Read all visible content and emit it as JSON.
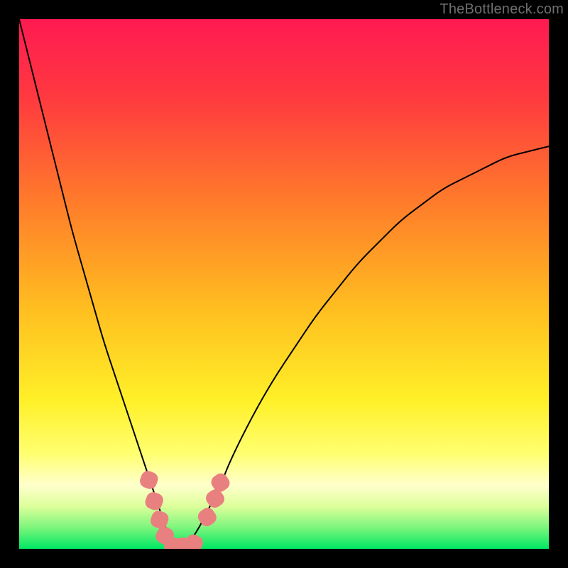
{
  "watermark": "TheBottleneck.com",
  "chart_data": {
    "type": "line",
    "title": "",
    "xlabel": "",
    "ylabel": "",
    "xlim": [
      0,
      100
    ],
    "ylim": [
      0,
      100
    ],
    "background": {
      "style": "vertical-gradient",
      "stops": [
        {
          "pos": 0.0,
          "color": "#ff1a52"
        },
        {
          "pos": 0.15,
          "color": "#ff3a3f"
        },
        {
          "pos": 0.35,
          "color": "#ff7d2a"
        },
        {
          "pos": 0.55,
          "color": "#ffbf20"
        },
        {
          "pos": 0.72,
          "color": "#fff028"
        },
        {
          "pos": 0.82,
          "color": "#ffff70"
        },
        {
          "pos": 0.88,
          "color": "#ffffcc"
        },
        {
          "pos": 0.92,
          "color": "#dcff9a"
        },
        {
          "pos": 0.96,
          "color": "#7cf57c"
        },
        {
          "pos": 1.0,
          "color": "#00e864"
        }
      ]
    },
    "series": [
      {
        "name": "bottleneck-curve",
        "stroke": "#000000",
        "stroke_width": 2,
        "x": [
          0,
          2,
          4,
          6,
          8,
          10,
          12,
          14,
          16,
          18,
          20,
          22,
          24,
          25,
          26,
          27,
          28,
          29,
          30,
          32,
          34,
          36,
          38,
          40,
          44,
          48,
          52,
          56,
          60,
          64,
          68,
          72,
          76,
          80,
          84,
          88,
          92,
          96,
          100
        ],
        "y": [
          100,
          92,
          84,
          76,
          68,
          60,
          53,
          46,
          39,
          33,
          27,
          21,
          15,
          12,
          9,
          6,
          3,
          1,
          0,
          1,
          4,
          8,
          12,
          17,
          25,
          32,
          38,
          44,
          49,
          54,
          58,
          62,
          65,
          68,
          70,
          72,
          74,
          75,
          76
        ]
      }
    ],
    "curve_minimum_x": 29,
    "markers": [
      {
        "name": "marker",
        "shape": "rounded-square",
        "fill": "#e98080",
        "size": 24,
        "x": 24.5,
        "y": 13.0,
        "rot": -70
      },
      {
        "name": "marker",
        "shape": "rounded-square",
        "fill": "#e98080",
        "size": 24,
        "x": 25.5,
        "y": 9.0,
        "rot": -70
      },
      {
        "name": "marker",
        "shape": "rounded-square",
        "fill": "#e98080",
        "size": 24,
        "x": 26.5,
        "y": 5.5,
        "rot": -70
      },
      {
        "name": "marker",
        "shape": "rounded-square",
        "fill": "#e98080",
        "size": 24,
        "x": 27.5,
        "y": 2.5,
        "rot": -60
      },
      {
        "name": "marker",
        "shape": "rounded-square",
        "fill": "#e98080",
        "size": 24,
        "x": 29.0,
        "y": 0.5,
        "rot": 0
      },
      {
        "name": "marker",
        "shape": "rounded-square",
        "fill": "#e98080",
        "size": 24,
        "x": 31.0,
        "y": 0.5,
        "rot": 0
      },
      {
        "name": "marker",
        "shape": "rounded-square",
        "fill": "#e98080",
        "size": 24,
        "x": 33.0,
        "y": 1.0,
        "rot": 25
      },
      {
        "name": "marker",
        "shape": "rounded-square",
        "fill": "#e98080",
        "size": 24,
        "x": 35.5,
        "y": 6.0,
        "rot": 55
      },
      {
        "name": "marker",
        "shape": "rounded-square",
        "fill": "#e98080",
        "size": 24,
        "x": 37.0,
        "y": 9.5,
        "rot": 55
      },
      {
        "name": "marker",
        "shape": "rounded-square",
        "fill": "#e98080",
        "size": 24,
        "x": 38.0,
        "y": 12.5,
        "rot": 55
      }
    ]
  }
}
